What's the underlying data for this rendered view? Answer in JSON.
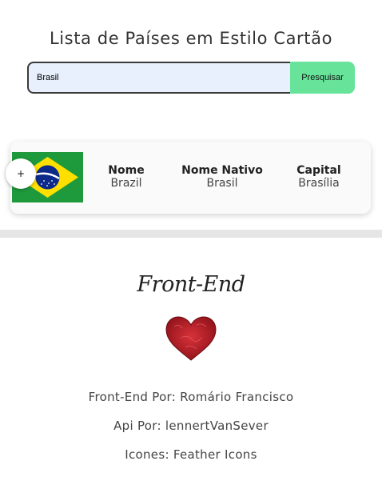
{
  "page": {
    "title": "Lista de Países em Estilo Cartão"
  },
  "search": {
    "value": "Brasil",
    "button_label": "Presquisar"
  },
  "card": {
    "expand_label": "+",
    "flag_country": "Brazil",
    "fields": [
      {
        "label": "Nome",
        "value": "Brazil"
      },
      {
        "label": "Nome Nativo",
        "value": "Brasil"
      },
      {
        "label": "Capital",
        "value": "Brasília"
      }
    ]
  },
  "footer": {
    "heading": "Front-End",
    "heart_icon": "heart-icon",
    "credits": [
      "Front-End Por: Romário Francisco",
      "Api Por: lennertVanSever",
      "Icones: Feather Icons"
    ]
  },
  "colors": {
    "accent_button": "#67e39a",
    "input_background": "#e8f0fe",
    "flag_green": "#1e9a3c",
    "flag_yellow": "#fedf00",
    "flag_blue": "#0b2a8a",
    "heart_red": "#c0202a"
  }
}
